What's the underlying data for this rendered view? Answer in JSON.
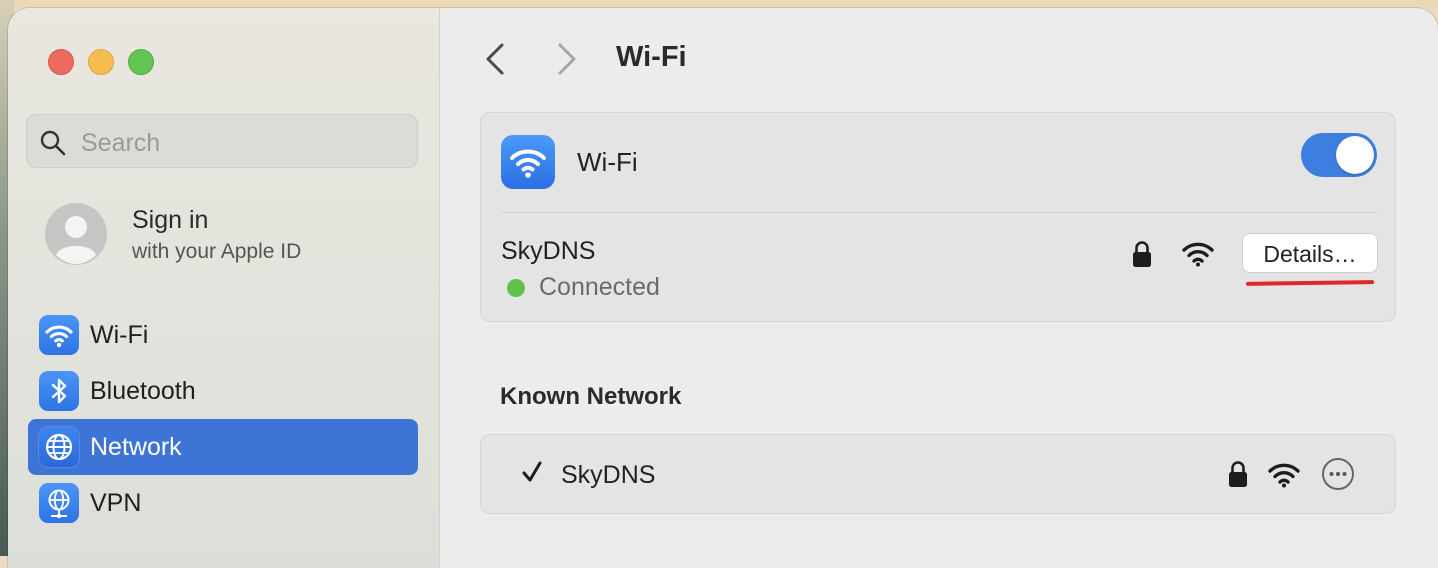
{
  "sidebar": {
    "search_placeholder": "Search",
    "account": {
      "title": "Sign in",
      "subtitle": "with your Apple ID"
    },
    "items": [
      {
        "label": "Wi-Fi",
        "icon": "wifi-icon",
        "selected": false
      },
      {
        "label": "Bluetooth",
        "icon": "bluetooth-icon",
        "selected": false
      },
      {
        "label": "Network",
        "icon": "globe-icon",
        "selected": true
      },
      {
        "label": "VPN",
        "icon": "vpn-globe-icon",
        "selected": false
      }
    ]
  },
  "header": {
    "title": "Wi-Fi"
  },
  "wifi_panel": {
    "label": "Wi-Fi",
    "enabled": true,
    "current_network": {
      "name": "SkyDNS",
      "status": "Connected",
      "status_color": "#5fc24c",
      "secured": true,
      "details_button": "Details…"
    }
  },
  "known": {
    "title": "Known Network",
    "networks": [
      {
        "name": "SkyDNS",
        "checked": true,
        "secured": true
      }
    ]
  },
  "colors": {
    "accent": "#3e74d6",
    "toggle_on": "#3d7fe0",
    "annotation": "#e0262b"
  }
}
